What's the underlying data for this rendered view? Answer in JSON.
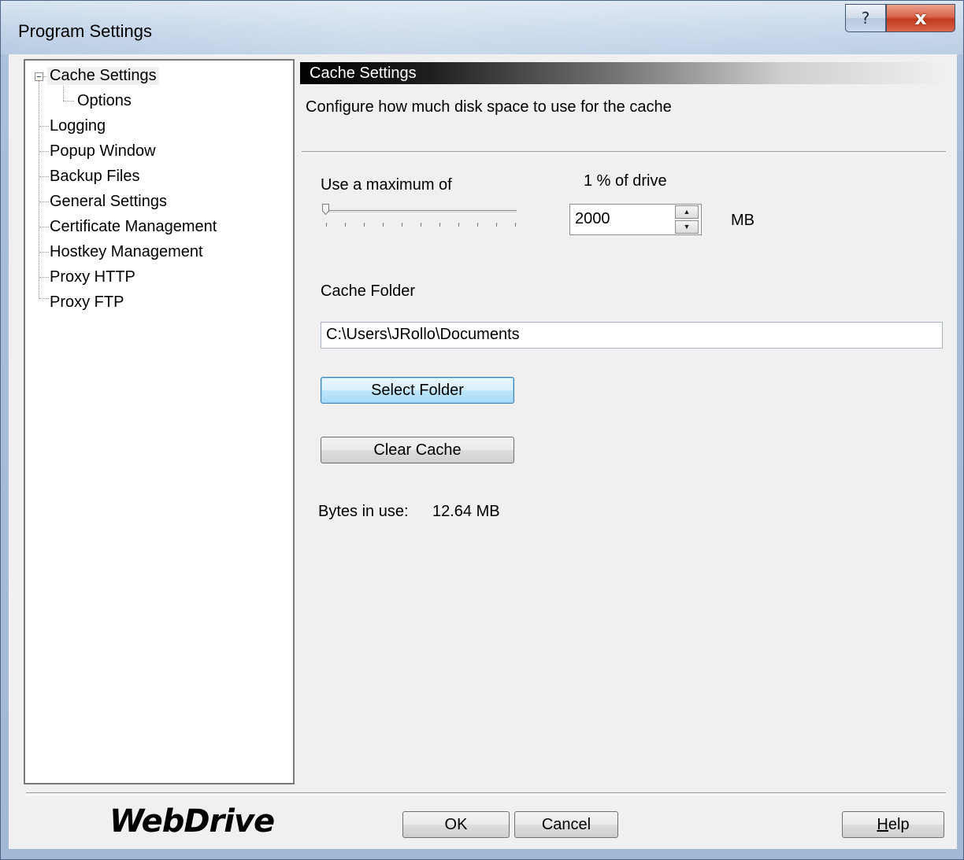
{
  "window": {
    "title": "Program Settings",
    "help_button": "?",
    "close_button": "x"
  },
  "tree": {
    "items": [
      {
        "label": "Cache Settings",
        "expander": "minus",
        "selected": true
      },
      {
        "label": "Options"
      },
      {
        "label": "Logging"
      },
      {
        "label": "Popup Window"
      },
      {
        "label": "Backup Files"
      },
      {
        "label": "General Settings"
      },
      {
        "label": "Certificate Management"
      },
      {
        "label": "Hostkey Management"
      },
      {
        "label": "Proxy HTTP"
      },
      {
        "label": "Proxy FTP"
      }
    ]
  },
  "panel": {
    "header": "Cache Settings",
    "description": "Configure how much disk space to use for the cache",
    "max_label": "Use a maximum of",
    "percent_label": "1 % of drive",
    "slider_value_percent": 1,
    "size_value": "2000",
    "size_unit": "MB",
    "folder_label": "Cache Folder",
    "folder_value": "C:\\Users\\JRollo\\Documents",
    "select_folder_button": "Select Folder",
    "clear_cache_button": "Clear Cache",
    "bytes_label": "Bytes in use:",
    "bytes_value": "12.64 MB"
  },
  "footer": {
    "logo": "WebDrive",
    "ok_button": "OK",
    "cancel_button": "Cancel",
    "help_button": "Help"
  },
  "colors": {
    "titlebar": "#c5d6ea",
    "close_button": "#c23a1c",
    "focus_button": "#bee6fd",
    "dialog_background": "#f0f0f0"
  }
}
